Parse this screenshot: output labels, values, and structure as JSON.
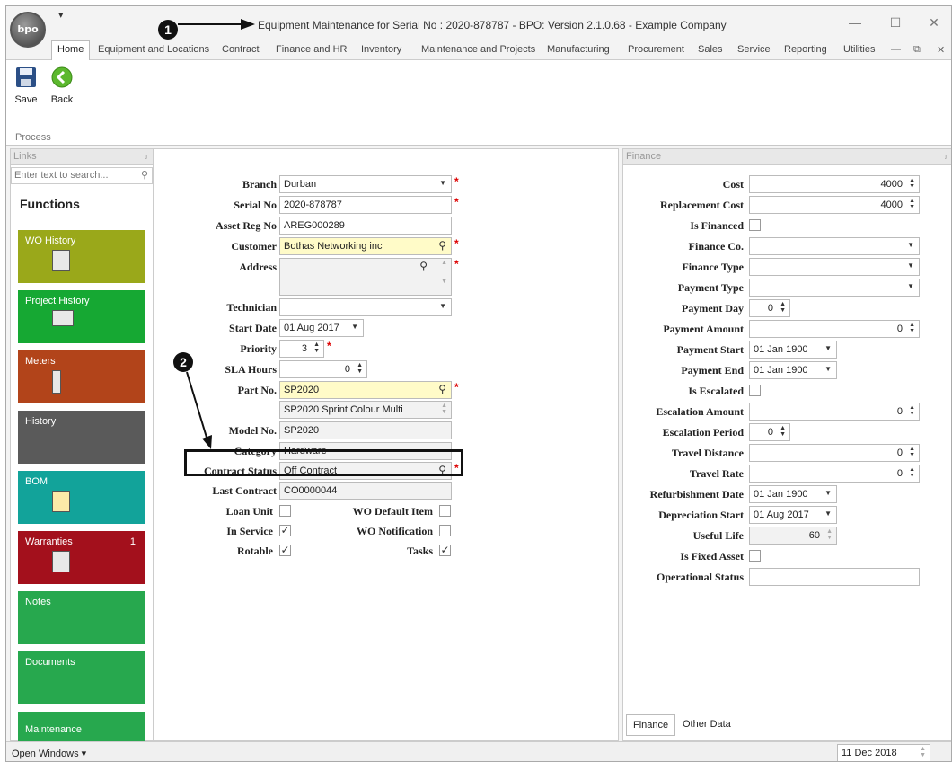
{
  "window": {
    "title": "Equipment Maintenance for Serial No : 2020-878787 - BPO: Version 2.1.0.68 - Example Company",
    "logo_text": "bpo"
  },
  "menu": [
    "Home",
    "Equipment and Locations",
    "Contract",
    "Finance and HR",
    "Inventory",
    "Maintenance and Projects",
    "Manufacturing",
    "Procurement",
    "Sales",
    "Service",
    "Reporting",
    "Utilities"
  ],
  "ribbon": {
    "save": "Save",
    "back": "Back",
    "group": "Process"
  },
  "links": {
    "title": "Links",
    "search_placeholder": "Enter text to search...",
    "functions": "Functions",
    "tiles": [
      {
        "label": "WO History",
        "color": "#9aa81a"
      },
      {
        "label": "Project History",
        "color": "#16a833"
      },
      {
        "label": "Meters",
        "color": "#b2441a"
      },
      {
        "label": "History",
        "color": "#5a5a5a"
      },
      {
        "label": "BOM",
        "color": "#12a39a"
      },
      {
        "label": "Warranties",
        "color": "#a3101c",
        "count": "1"
      },
      {
        "label": "Notes",
        "color": "#27a84e"
      },
      {
        "label": "Documents",
        "color": "#27a84e"
      },
      {
        "label": "Maintenance",
        "color": "#27a84e"
      }
    ]
  },
  "form": {
    "branch": {
      "label": "Branch",
      "value": "Durban"
    },
    "serial": {
      "label": "Serial No",
      "value": "2020-878787"
    },
    "assetreg": {
      "label": "Asset Reg No",
      "value": "AREG000289"
    },
    "customer": {
      "label": "Customer",
      "value": "Bothas Networking inc"
    },
    "address": {
      "label": "Address",
      "value": ""
    },
    "technician": {
      "label": "Technician",
      "value": ""
    },
    "startdate": {
      "label": "Start Date",
      "value": "01 Aug 2017"
    },
    "priority": {
      "label": "Priority",
      "value": "3"
    },
    "sla": {
      "label": "SLA Hours",
      "value": "0"
    },
    "partno": {
      "label": "Part No.",
      "value": "SP2020",
      "desc": "SP2020 Sprint Colour Multi"
    },
    "model": {
      "label": "Model No.",
      "value": "SP2020"
    },
    "category": {
      "label": "Category",
      "value": "Hardware"
    },
    "contractstatus": {
      "label": "Contract Status",
      "value": "Off Contract"
    },
    "lastcontract": {
      "label": "Last Contract",
      "value": "CO0000044"
    },
    "loanunit": {
      "label": "Loan Unit",
      "checked": false
    },
    "wodefault": {
      "label": "WO Default Item",
      "checked": false
    },
    "inservice": {
      "label": "In Service",
      "checked": true
    },
    "wonotif": {
      "label": "WO Notification",
      "checked": false
    },
    "rotable": {
      "label": "Rotable",
      "checked": true
    },
    "tasks": {
      "label": "Tasks",
      "checked": true
    }
  },
  "finance": {
    "title": "Finance",
    "cost": {
      "label": "Cost",
      "value": "4000"
    },
    "repcost": {
      "label": "Replacement Cost",
      "value": "4000"
    },
    "isfinanced": {
      "label": "Is Financed"
    },
    "financeco": {
      "label": "Finance Co.",
      "value": ""
    },
    "financetype": {
      "label": "Finance Type",
      "value": ""
    },
    "paytype": {
      "label": "Payment Type",
      "value": ""
    },
    "payday": {
      "label": "Payment Day",
      "value": "0"
    },
    "payamount": {
      "label": "Payment Amount",
      "value": "0"
    },
    "paystart": {
      "label": "Payment Start",
      "value": "01 Jan 1900"
    },
    "payend": {
      "label": "Payment End",
      "value": "01 Jan 1900"
    },
    "isescalated": {
      "label": "Is Escalated"
    },
    "escamount": {
      "label": "Escalation Amount",
      "value": "0"
    },
    "escperiod": {
      "label": "Escalation Period",
      "value": "0"
    },
    "traveldist": {
      "label": "Travel Distance",
      "value": "0"
    },
    "travelrate": {
      "label": "Travel Rate",
      "value": "0"
    },
    "refurb": {
      "label": "Refurbishment Date",
      "value": "01 Jan 1900"
    },
    "depstart": {
      "label": "Depreciation Start",
      "value": "01 Aug 2017"
    },
    "usefullife": {
      "label": "Useful Life",
      "value": "60"
    },
    "isfixed": {
      "label": "Is Fixed Asset"
    },
    "opstatus": {
      "label": "Operational Status",
      "value": ""
    },
    "tabs": [
      "Finance",
      "Other Data"
    ]
  },
  "status": {
    "open_windows": "Open Windows",
    "date": "11 Dec 2018"
  },
  "annotations": [
    "1",
    "2"
  ]
}
